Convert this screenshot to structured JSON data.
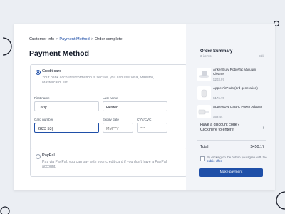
{
  "breadcrumb": [
    "Customer Info",
    "Payment Method",
    "Order complete"
  ],
  "page_title": "Payment Method",
  "credit_card": {
    "label": "Credit card",
    "description": "Your bank account information is secure, you can use Visa, Maestro, Mastercard, ect.",
    "first_name_label": "First name",
    "first_name_value": "Carly",
    "last_name_label": "Last name",
    "last_name_value": "Hester",
    "card_number_label": "Card number",
    "card_number_value": "2823 53|",
    "expiry_label": "Expiry date",
    "expiry_placeholder": "MM/YY",
    "cvv_label": "CVV/CVC",
    "cvv_placeholder": "***"
  },
  "paypal": {
    "label": "PayPal",
    "description": "Pay via PayPal; you can pay with your credit card if you don't have a PayPal account."
  },
  "order_summary": {
    "title": "Order Summary",
    "count": "3 items",
    "edit": "Edit",
    "items": [
      {
        "name": "Anker Eufy RoboVac Vacuum Cleaner",
        "price": "$203.97"
      },
      {
        "name": "Apple AirPods (3rd generation)",
        "price": "$176.76"
      },
      {
        "name": "Apple 61W USB-C Power Adapter",
        "price": "$69.44"
      }
    ],
    "discount": [
      "Have a discount code?",
      "Click here to enter it"
    ],
    "total_label": "Total",
    "total_value": "$450.17",
    "terms_prefix": "By clicking on the button you agree with the",
    "terms_link": "public offer",
    "pay_button": "Make payment"
  },
  "colors": {
    "accent": "#1f4fa8",
    "background": "#ebeef3",
    "summary_bg": "#f2f4f8"
  }
}
